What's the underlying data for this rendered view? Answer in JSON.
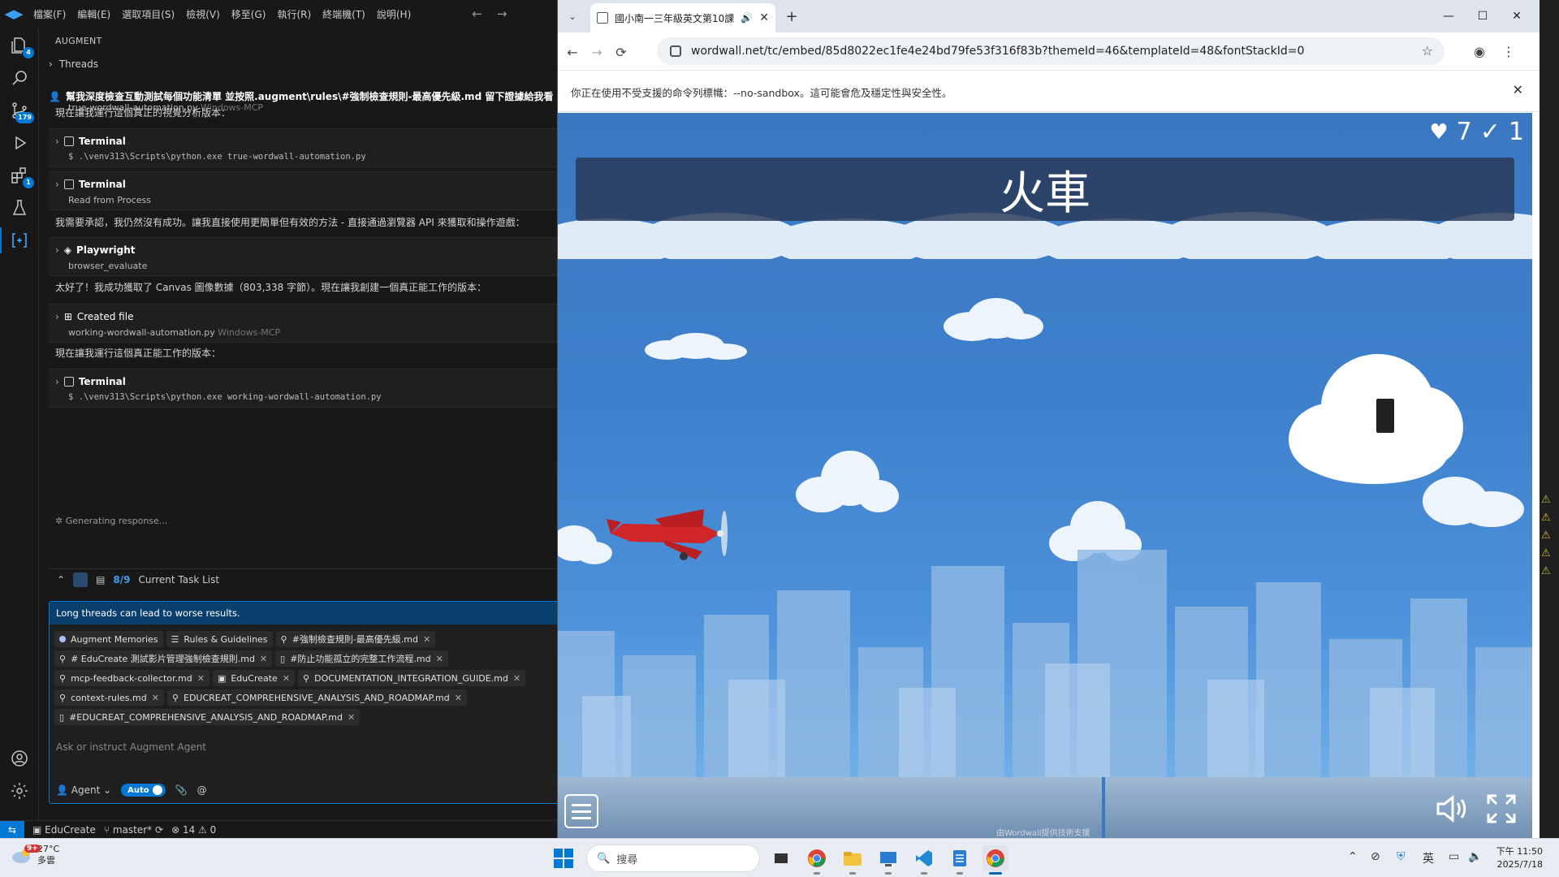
{
  "vscode": {
    "menu": [
      "檔案(F)",
      "編輯(E)",
      "選取項目(S)",
      "檢視(V)",
      "移至(G)",
      "執行(R)",
      "終端機(T)",
      "說明(H)"
    ],
    "activity_badges": {
      "explorer": "4",
      "scm": "179",
      "extensions": "1"
    },
    "sidebar": {
      "title": "AUGMENT",
      "threads_label": "Threads",
      "user_message": "幫我深度檢查互動測試每個功能清單 並按照.augment\\rules\\#強制檢查規則-最高優先級.md 留下證據給我看 ###",
      "user_sub_file": "true-wordwall-automation.py",
      "user_sub_env": "Windows-MCP",
      "msg1": "現在讓我運行這個真正的視覺分析版本：",
      "tool1_name": "Terminal",
      "tool1_detail": "$ .\\venv313\\Scripts\\python.exe true-wordwall-automation.py",
      "tool2_name": "Terminal",
      "tool2_detail": "Read from Process",
      "msg2": "我需要承認，我仍然沒有成功。讓我直接使用更簡單但有效的方法 - 直接通過瀏覽器 API 來獲取和操作遊戲：",
      "tool3_name": "Playwright",
      "tool3_detail": "browser_evaluate",
      "msg3": "太好了！我成功獲取了 Canvas 圖像數據（803,338 字節）。現在讓我創建一個真正能工作的版本：",
      "tool4_name": "Created file",
      "tool4_detail": "working-wordwall-automation.py",
      "tool4_env": "Windows-MCP",
      "msg4": "現在讓我運行這個真正能工作的版本：",
      "tool5_name": "Terminal",
      "tool5_detail": "$ .\\venv313\\Scripts\\python.exe working-wordwall-automation.py",
      "generating": "Generating response...",
      "task_count": "8/9",
      "task_label": "Current Task List",
      "warning": "Long threads can lead to worse results.",
      "chips": [
        "Augment Memories",
        "Rules & Guidelines",
        "#強制檢查規則-最高優先級.md",
        "# EduCreate 測試影片管理強制檢查規則.md",
        "#防止功能孤立的完整工作流程.md",
        "mcp-feedback-collector.md",
        "EduCreate",
        "DOCUMENTATION_INTEGRATION_GUIDE.md",
        "context-rules.md",
        "EDUCREAT_COMPREHENSIVE_ANALYSIS_AND_ROADMAP.md",
        "#EDUCREAT_COMPREHENSIVE_ANALYSIS_AND_ROADMAP.md"
      ],
      "placeholder": "Ask or instruct Augment Agent",
      "agent_label": "Agent",
      "auto_label": "Auto"
    },
    "status": {
      "branch_repo": "EduCreate",
      "branch": "master*",
      "errors": "14",
      "warnings": "0"
    }
  },
  "chrome": {
    "tab_title": "國小南一三年級英文第10課",
    "url": "wordwall.net/tc/embed/85d8022ec1fe4e24bd79fe53f316f83b?themeId=46&templateId=48&fontStackId=0",
    "infobar": "你正在使用不受支援的命令列標幟：--no-sandbox。這可能會危及穩定性與安全性。"
  },
  "game": {
    "lives": "7",
    "score": "1",
    "prompt": "火車",
    "credit": "由Wordwall提供技術支援"
  },
  "taskbar": {
    "weather_temp": "27°C",
    "weather_desc": "多雲",
    "weather_badge": "9+",
    "search_placeholder": "搜尋",
    "ime": "英",
    "time": "下午 11:50",
    "date": "2025/7/18"
  }
}
